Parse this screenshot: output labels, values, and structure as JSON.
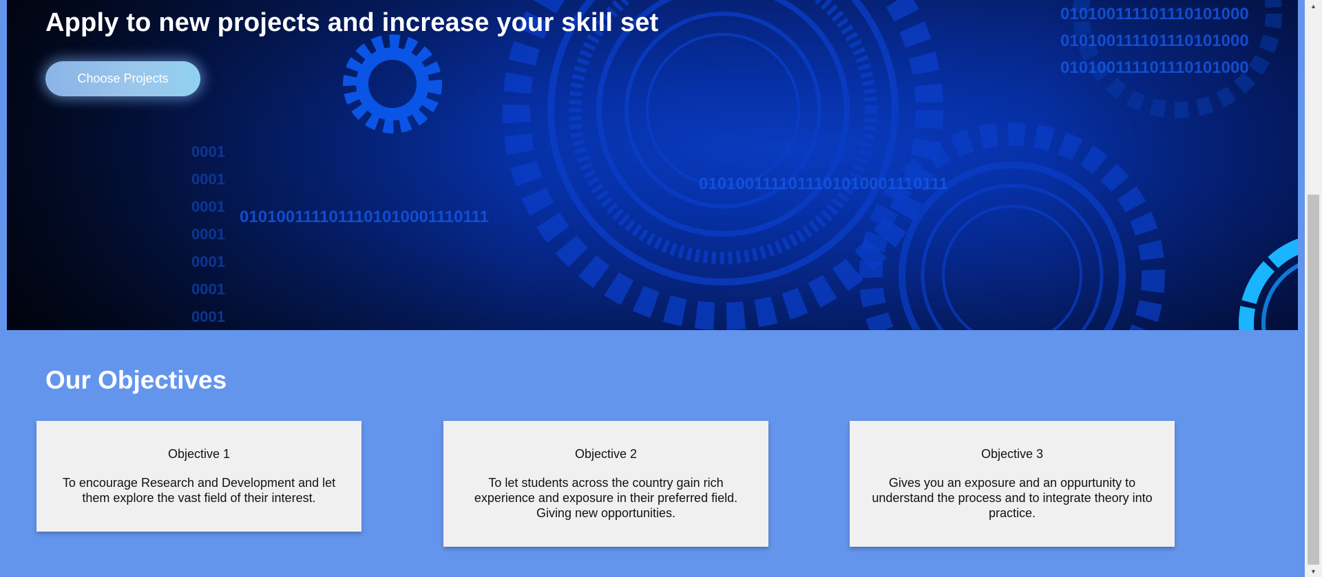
{
  "hero": {
    "title": "Apply to new projects and increase your skill set",
    "cta_label": "Choose Projects",
    "binary_strings": [
      "0101001111011101010001110111",
      "010100111101110101000",
      "0001"
    ]
  },
  "objectives": {
    "heading": "Our Objectives",
    "items": [
      {
        "title": "Objective 1",
        "text": "To encourage Research and Development and let them explore the vast field of their interest."
      },
      {
        "title": "Objective 2",
        "text": "To let students across the country gain rich experience and exposure in their preferred field. Giving new opportunities."
      },
      {
        "title": "Objective 3",
        "text": "Gives you an exposure and an oppurtunity to understand the process and to integrate theory into practice."
      }
    ]
  },
  "scrollbar": {
    "up_icon": "chevron-up-icon",
    "down_icon": "chevron-down-icon"
  },
  "colors": {
    "page_background": "#6495ED",
    "hero_deep": "#020e33",
    "hero_bright": "#0a3bbf",
    "card_background": "#f0f0f0"
  }
}
